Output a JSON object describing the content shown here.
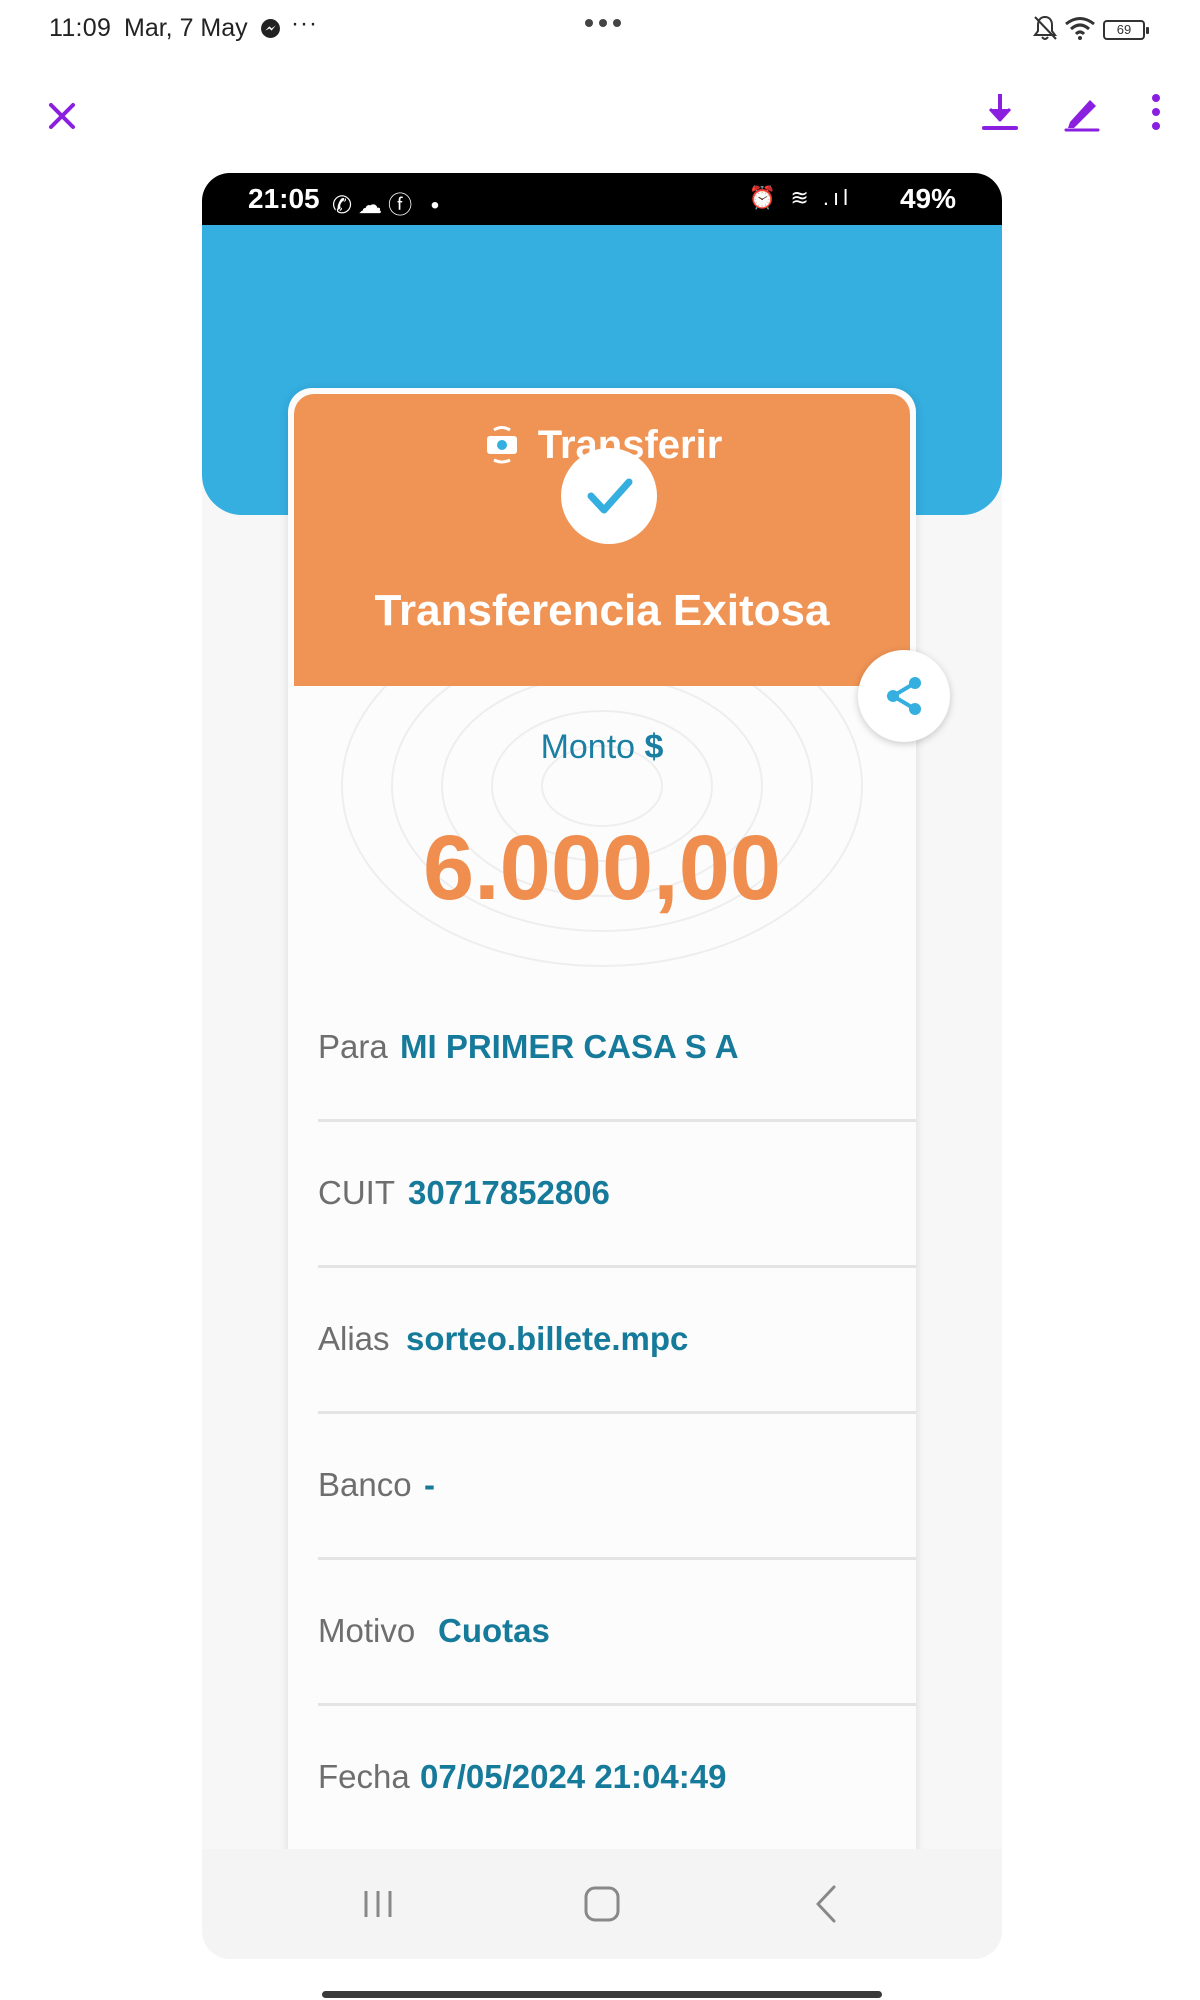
{
  "status_bar": {
    "time": "11:09",
    "date": "Mar, 7 May",
    "more": "···",
    "battery": "69"
  },
  "toolbar": {
    "close_icon": "close-icon",
    "download_icon": "download-icon",
    "edit_icon": "edit-icon",
    "menu_icon": "more-vert-icon",
    "accent_color": "#8a1fe0"
  },
  "phone": {
    "status": {
      "time": "21:05",
      "notif_icons": "✆☁ⓕ •",
      "battery": "49%",
      "signal_icons": "⏰ ≋ .ıl"
    },
    "header": {
      "title": "Transferir",
      "color": "#35aee0"
    },
    "card": {
      "status_title": "Transferencia Exitosa",
      "status_color": "#f09455",
      "amount_label": "Monto",
      "currency": "$",
      "amount": "6.000,00",
      "amount_color": "#ef8e4f"
    },
    "details": [
      {
        "label": "Para",
        "value": "MI PRIMER CASA S A"
      },
      {
        "label": "CUIT",
        "value": "30717852806"
      },
      {
        "label": "Alias",
        "value": "sorteo.billete.mpc"
      },
      {
        "label": "Banco",
        "value": "-"
      },
      {
        "label": "Motivo",
        "value": "Cuotas"
      },
      {
        "label": "Fecha",
        "value": "07/05/2024 21:04:49"
      }
    ]
  }
}
